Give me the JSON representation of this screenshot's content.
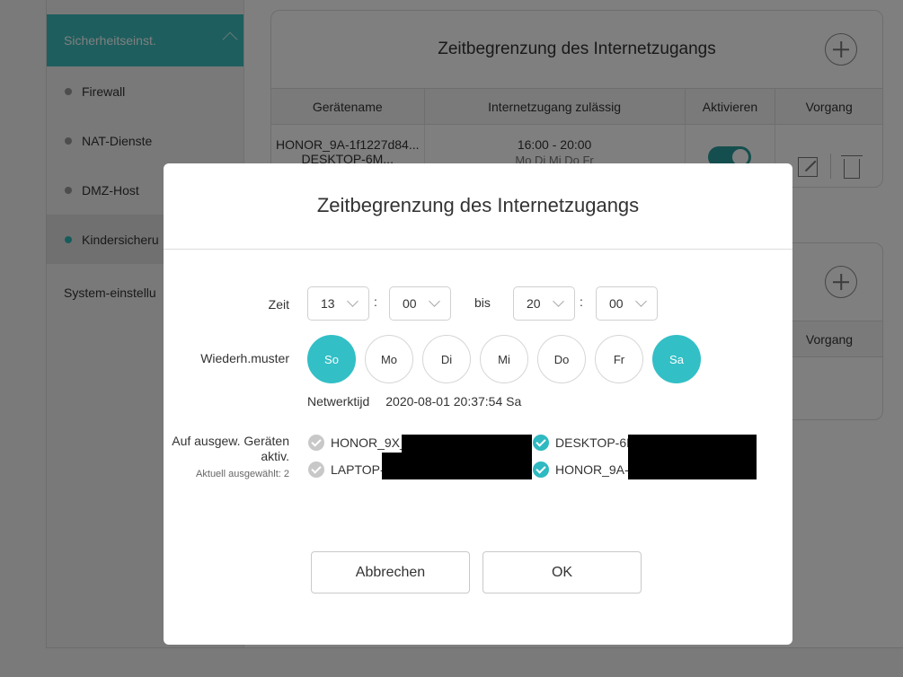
{
  "sidebar": {
    "section": "Sicherheitseinst.",
    "items": [
      {
        "label": "Firewall"
      },
      {
        "label": "NAT-Dienste"
      },
      {
        "label": "DMZ-Host"
      },
      {
        "label": "Kindersicheru"
      }
    ],
    "system": "System-einstellu"
  },
  "card1": {
    "title": "Zeitbegrenzung des Internetzugangs",
    "headers": [
      "Gerätename",
      "Internetzugang zulässig",
      "Aktivieren",
      "Vorgang"
    ],
    "row": {
      "device": "HONOR_9A-1f1227d84...",
      "device2": "DESKTOP-6M...",
      "time": "16:00 - 20:00",
      "days": "Mo Di Mi Do Fr"
    }
  },
  "card2": {
    "header_vorgang": "Vorgang"
  },
  "modal": {
    "title": "Zeitbegrenzung des Internetzugangs",
    "zeit_label": "Zeit",
    "start_hour": "13",
    "start_min": "00",
    "bis_label": "bis",
    "end_hour": "20",
    "end_min": "00",
    "colon": ":",
    "repeat_label": "Wiederh.muster",
    "days": [
      {
        "label": "So",
        "active": true
      },
      {
        "label": "Mo",
        "active": false
      },
      {
        "label": "Di",
        "active": false
      },
      {
        "label": "Mi",
        "active": false
      },
      {
        "label": "Do",
        "active": false
      },
      {
        "label": "Fr",
        "active": false
      },
      {
        "label": "Sa",
        "active": true
      }
    ],
    "net_time_label": "Netwerktijd",
    "net_time_value": "2020-08-01 20:37:54 Sa",
    "devices_label": "Auf ausgew. Geräten aktiv.",
    "devices_selected": "Aktuell ausgewählt: 2",
    "devices": [
      {
        "name": "HONOR_9X_",
        "checked": false
      },
      {
        "name": "DESKTOP-6M",
        "checked": true
      },
      {
        "name": "LAPTOP-",
        "checked": false
      },
      {
        "name": "HONOR_9A-",
        "checked": true
      }
    ],
    "cancel_label": "Abbrechen",
    "ok_label": "OK"
  },
  "colors": {
    "accent": "#33bfc6",
    "sidebar_active": "#3cbcbc"
  }
}
